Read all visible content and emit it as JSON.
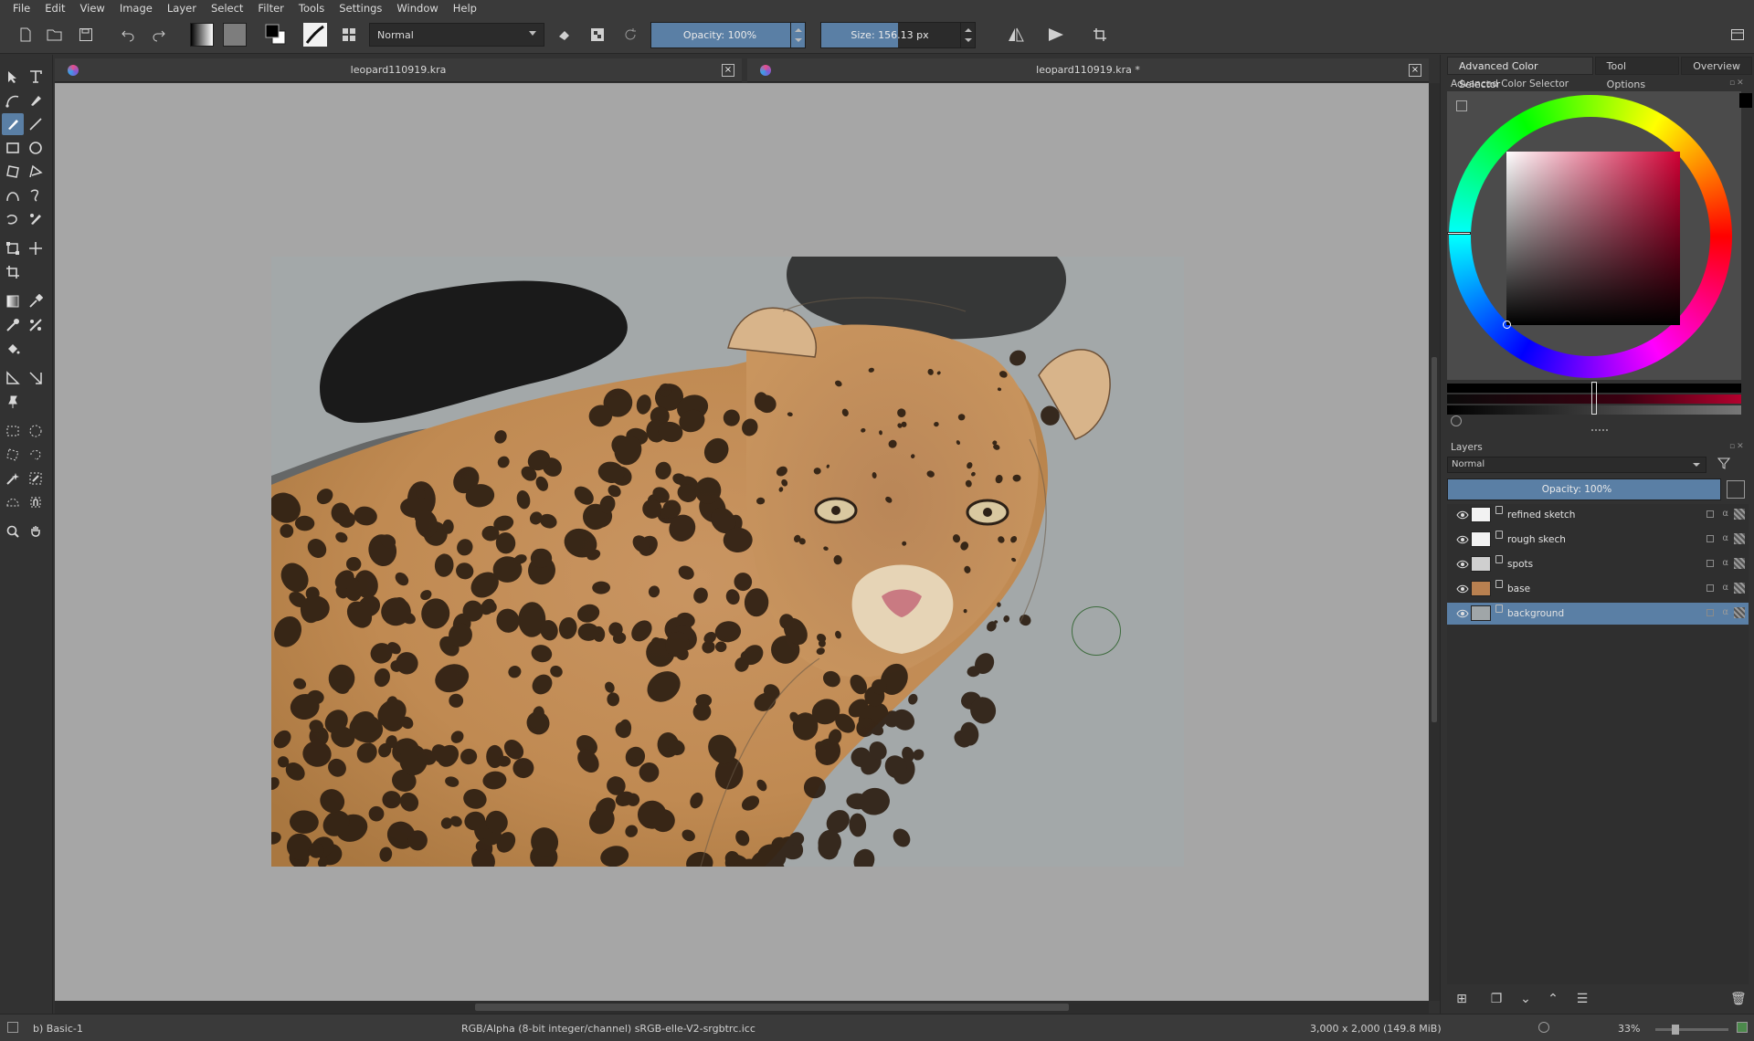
{
  "menu": [
    "File",
    "Edit",
    "View",
    "Image",
    "Layer",
    "Select",
    "Filter",
    "Tools",
    "Settings",
    "Window",
    "Help"
  ],
  "toolbar": {
    "blend_mode": "Normal",
    "opacity_label": "Opacity: 100%",
    "opacity_value": 100,
    "size_label": "Size: 156.13 px",
    "size_fraction": 0.5
  },
  "documents": [
    {
      "title": "leopard110919.kra",
      "close": "×"
    },
    {
      "title": "leopard110919.kra *",
      "close": "×"
    }
  ],
  "dock": {
    "tabs": [
      "Advanced Color Selector",
      "Tool Options",
      "Overview"
    ],
    "color_selector_title": "Advanced Color Selector",
    "current_color": "#000000",
    "hue_color": "#d10034",
    "layers_title": "Layers",
    "layer_blend": "Normal",
    "layer_opacity_label": "Opacity:  100%",
    "layer_opacity": 100
  },
  "layers": [
    {
      "name": "refined sketch",
      "thumb": "#f2f2f2",
      "selected": false
    },
    {
      "name": "rough skech",
      "thumb": "#f2f2f2",
      "selected": false
    },
    {
      "name": "spots",
      "thumb": "#cfcfcf",
      "selected": false
    },
    {
      "name": "base",
      "thumb": "#b88050",
      "selected": false
    },
    {
      "name": "background",
      "thumb": "#a0a6a8",
      "selected": true
    }
  ],
  "status": {
    "brush": "b) Basic-1",
    "color_profile": "RGB/Alpha (8-bit integer/channel)  sRGB-elle-V2-srgbtrc.icc",
    "image_size": "3,000 x 2,000 (149.8 MiB)",
    "zoom": "33%",
    "zoom_fraction": 0.25
  },
  "colors": {
    "accent": "#5a7fa5",
    "panel": "#323232",
    "canvas_bg": "#a6a6a6",
    "image_bg": "#a3a8a9"
  }
}
